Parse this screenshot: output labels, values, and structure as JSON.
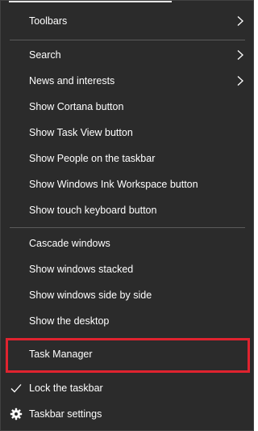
{
  "menu": {
    "toolbars": "Toolbars",
    "search": "Search",
    "news": "News and interests",
    "cortana": "Show Cortana button",
    "taskview": "Show Task View button",
    "people": "Show People on the taskbar",
    "ink": "Show Windows Ink Workspace button",
    "touch": "Show touch keyboard button",
    "cascade": "Cascade windows",
    "stacked": "Show windows stacked",
    "sidebyside": "Show windows side by side",
    "desktop": "Show the desktop",
    "taskmanager": "Task Manager",
    "lock": "Lock the taskbar",
    "settings": "Taskbar settings"
  },
  "icons": {
    "submenu": "chevron-right-icon",
    "checked": "checkmark-icon",
    "settings": "gear-icon"
  },
  "colors": {
    "menu_background": "#2b2b2b",
    "text": "#ffffff",
    "separator": "#5a5a5a",
    "highlight_border": "#e0232f"
  }
}
